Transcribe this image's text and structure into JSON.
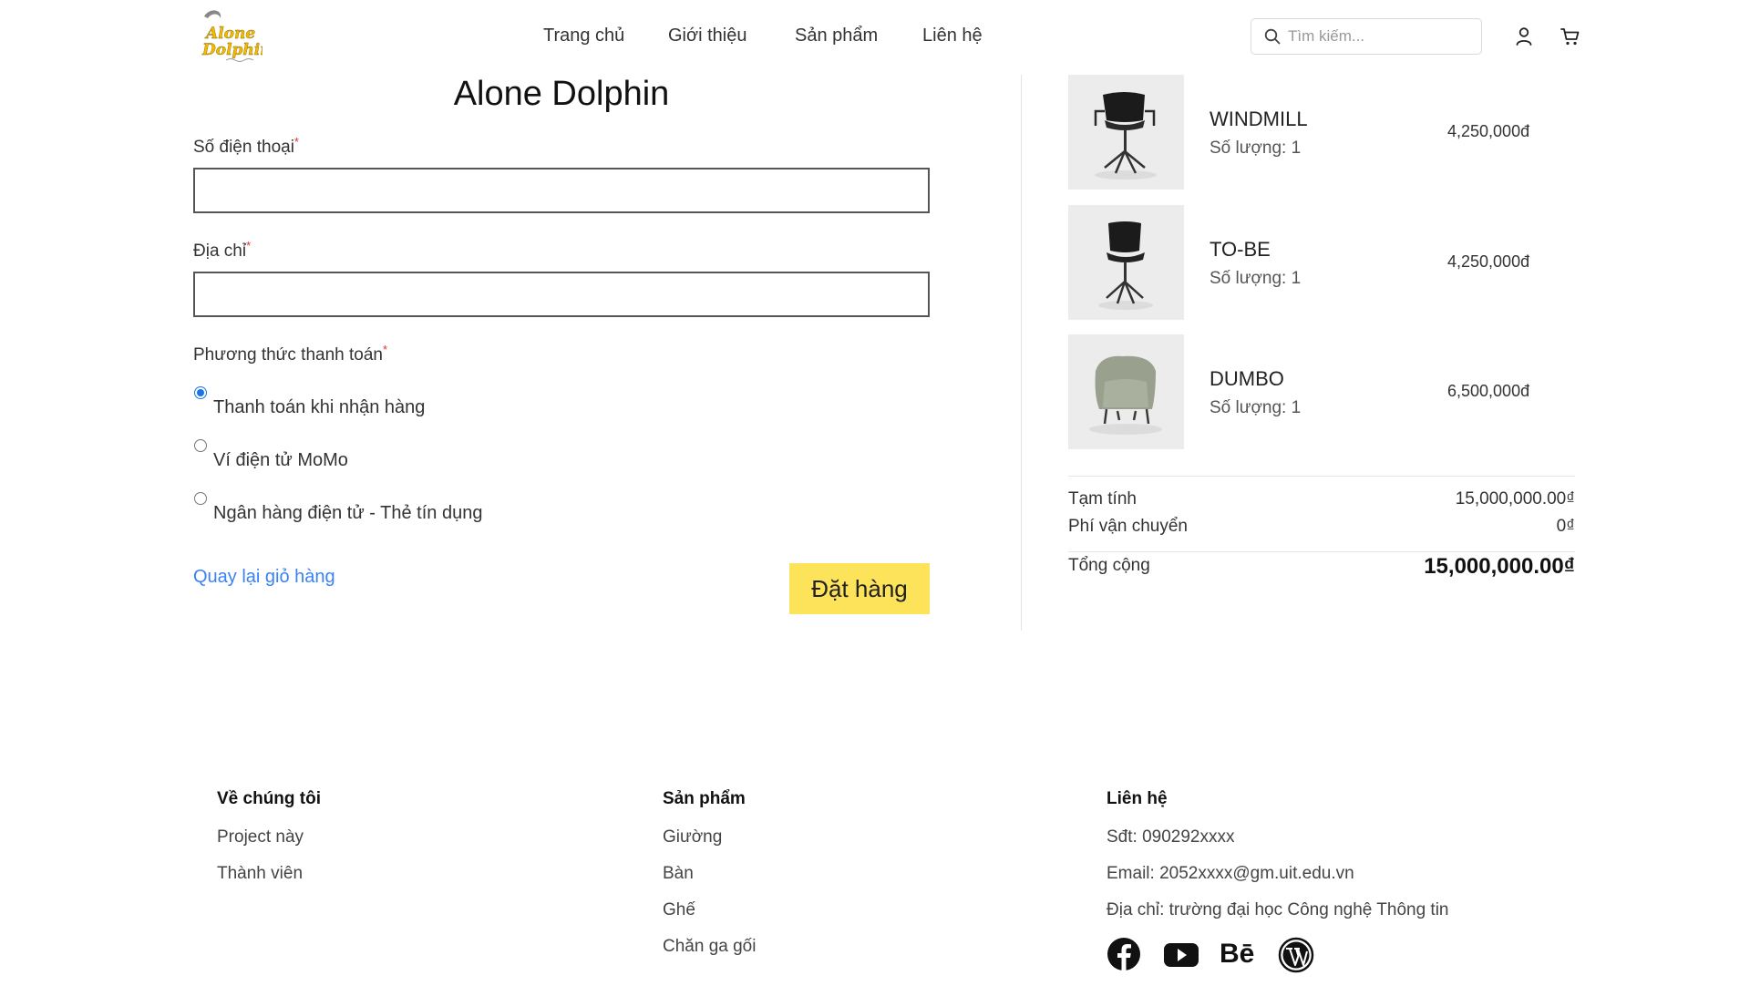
{
  "header": {
    "brand": "Alone Dolphin",
    "nav": [
      "Trang chủ",
      "Giới thiệu",
      "Sản phẩm",
      "Liên hệ"
    ],
    "search_placeholder": "Tìm kiếm...",
    "icons": [
      "search-icon",
      "user-icon",
      "cart-icon"
    ]
  },
  "form": {
    "title": "Alone Dolphin",
    "phone_label": "Số điện thoại",
    "address_label": "Địa chỉ",
    "required_mark": "*",
    "payment_label": "Phương thức thanh toán",
    "payment_options": [
      {
        "label": "Thanh toán khi nhận hàng",
        "checked": true
      },
      {
        "label": "Ví điện tử MoMo",
        "checked": false
      },
      {
        "label": "Ngân hàng điện tử - Thẻ tín dụng",
        "checked": false
      }
    ],
    "back_link": "Quay lại giỏ hàng",
    "submit": "Đặt hàng"
  },
  "cart": {
    "items": [
      {
        "name": "WINDMILL",
        "qty": "Số lượng: 1",
        "price": "4,250,000đ"
      },
      {
        "name": "TO-BE",
        "qty": "Số lượng: 1",
        "price": "4,250,000đ"
      },
      {
        "name": "DUMBO",
        "qty": "Số lượng: 1",
        "price": "6,500,000đ"
      }
    ],
    "subtotal_label": "Tạm tính",
    "subtotal_value": "15,000,000.00₫",
    "shipping_label": "Phí vận chuyển",
    "shipping_value": "0₫",
    "total_label": "Tổng cộng",
    "total_value": "15,000,000.00₫"
  },
  "footer": {
    "about": {
      "title": "Về chúng tôi",
      "items": [
        "Project này",
        "Thành viên"
      ]
    },
    "products": {
      "title": "Sản phẩm",
      "items": [
        "Giường",
        "Bàn",
        "Ghế",
        "Chăn ga gối"
      ]
    },
    "contact": {
      "title": "Liên hệ",
      "items": [
        "Sđt: 090292xxxx",
        "Email: 2052xxxx@gm.uit.edu.vn",
        "Địa chỉ: trường đại học Công nghệ Thông tin"
      ]
    },
    "social": [
      "facebook-icon",
      "youtube-icon",
      "behance-icon",
      "wordpress-icon"
    ],
    "behance_text": "Bē"
  },
  "colors": {
    "accent_button": "#fde35a",
    "link": "#3b82f6",
    "required": "#e0342d",
    "radio_checked": "#1a73e8",
    "logo_yellow": "#f2b900"
  }
}
